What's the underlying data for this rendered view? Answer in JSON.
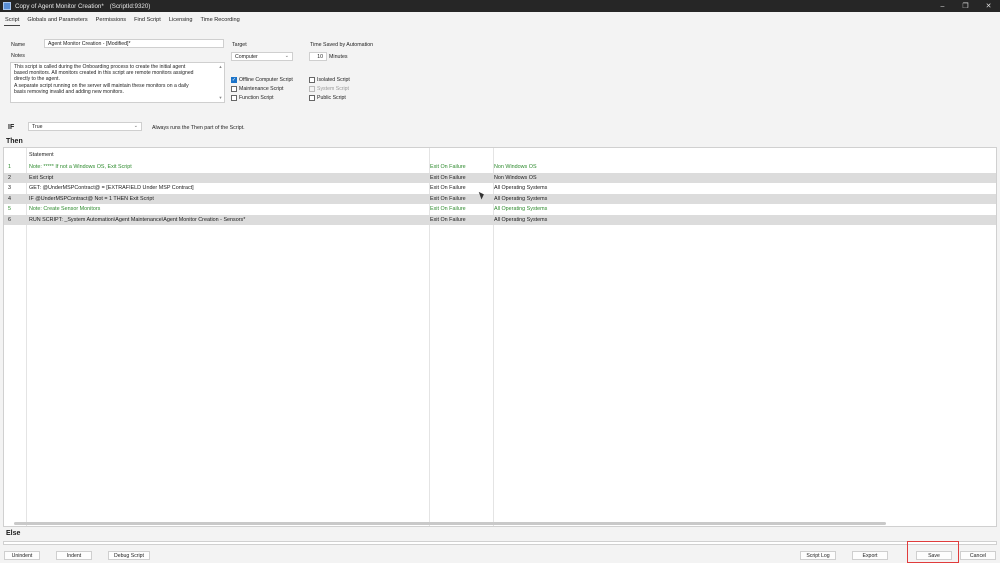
{
  "window": {
    "title": "Copy of Agent Monitor Creation*",
    "subtitle": "(ScriptId:9320)",
    "controls": {
      "minimize": "–",
      "restore": "❐",
      "close": "✕"
    }
  },
  "tabs": [
    "Script",
    "Globals and Parameters",
    "Permissions",
    "Find Script",
    "Licensing",
    "Time Recording"
  ],
  "form": {
    "name_label": "Name",
    "name_value": "Agent Monitor Creation - [Modified]*",
    "notes_label": "Notes",
    "notes_lines": [
      "This script is called during the Onboarding process to create the initial agent",
      "based monitors.  All monitors created in this script are remote monitors assigned",
      "directly to the agent.",
      "A separate script running on the server will maintain these monitors on a daily",
      "basis removing invalid and adding new monitors."
    ],
    "target_label": "Target",
    "target_value": "Computer",
    "time_saved_label": "Time Saved by Automation",
    "time_saved_value": "10",
    "time_saved_unit": "Minutes"
  },
  "checkboxes": {
    "offline": {
      "label": "Offline Computer Script",
      "checked": true
    },
    "maintenance": {
      "label": "Maintenance Script",
      "checked": false
    },
    "function": {
      "label": "Function Script",
      "checked": false
    },
    "isolated": {
      "label": "Isolated Script",
      "checked": false
    },
    "system": {
      "label": "System Script",
      "checked": false
    },
    "public": {
      "label": "Public Script",
      "checked": false
    }
  },
  "if_section": {
    "label": "IF",
    "condition": "True",
    "hint": "Always runs the Then part of the Script."
  },
  "then_label": "Then",
  "else_label": "Else",
  "grid": {
    "header": "Statement",
    "rows": [
      {
        "num": "1",
        "stmt": "Note: ***** If not a Windows OS, Exit Script",
        "fail": "Exit On Failure",
        "os": "Non Windows OS",
        "note": true
      },
      {
        "num": "2",
        "stmt": "   Exit Script",
        "fail": "Exit On Failure",
        "os": "Non Windows OS",
        "note": false
      },
      {
        "num": "3",
        "stmt": "GET:  @UnderMSPContract@  =  [EXTRAFIELD Under MSP Contract]",
        "fail": "Exit On Failure",
        "os": "All Operating Systems",
        "note": false
      },
      {
        "num": "4",
        "stmt": "IF  @UnderMSPContract@  Not  =  1  THEN  Exit Script",
        "fail": "Exit On Failure",
        "os": "All Operating Systems",
        "note": false
      },
      {
        "num": "5",
        "stmt": "Note: Create Sensor Monitors",
        "fail": "Exit On Failure",
        "os": "All Operating Systems",
        "note": true
      },
      {
        "num": "6",
        "stmt": "   RUN SCRIPT:  _System Automation\\Agent Maintenance\\Agent Monitor Creation - Sensors*",
        "fail": "Exit On Failure",
        "os": "All Operating Systems",
        "note": false
      }
    ]
  },
  "buttons": {
    "unindent": "Unindent",
    "indent": "Indent",
    "debug": "Debug Script",
    "script_log": "Script Log",
    "export": "Export",
    "save": "Save",
    "cancel": "Cancel"
  }
}
